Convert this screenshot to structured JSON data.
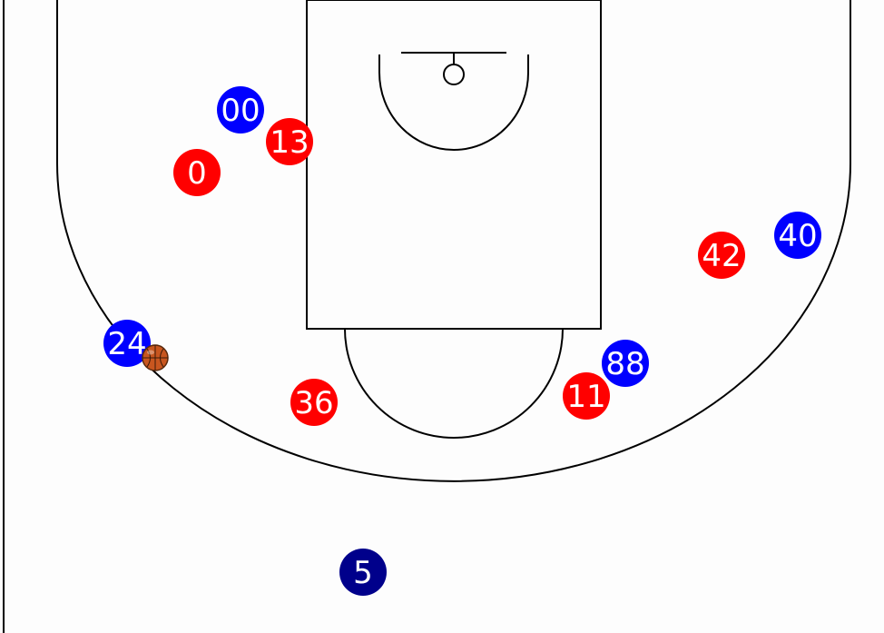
{
  "colors": {
    "background": "#fdfdfd",
    "court_lines": "#000000",
    "red_team": "#ff0000",
    "blue_team": "#0000ff",
    "navy_player": "#00008b",
    "ball": "#c8561f"
  },
  "players": [
    {
      "number": "00",
      "team": "blue"
    },
    {
      "number": "13",
      "team": "red"
    },
    {
      "number": "0",
      "team": "red"
    },
    {
      "number": "40",
      "team": "blue"
    },
    {
      "number": "42",
      "team": "red"
    },
    {
      "number": "24",
      "team": "blue"
    },
    {
      "number": "88",
      "team": "blue"
    },
    {
      "number": "11",
      "team": "red"
    },
    {
      "number": "36",
      "team": "red"
    },
    {
      "number": "5",
      "team": "navy"
    }
  ],
  "ball": {
    "icon": "basketball-icon"
  }
}
